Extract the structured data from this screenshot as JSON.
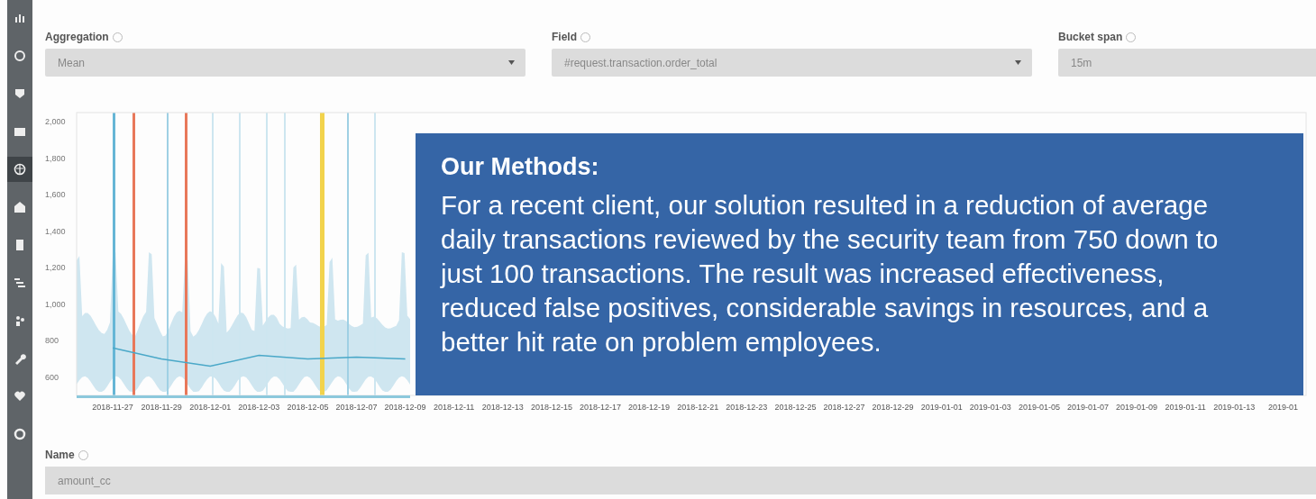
{
  "sidebar": {
    "items": [
      {
        "selected": false
      },
      {
        "selected": false
      },
      {
        "selected": false
      },
      {
        "selected": false
      },
      {
        "selected": true
      },
      {
        "selected": false
      },
      {
        "selected": false
      },
      {
        "selected": false
      },
      {
        "selected": false
      },
      {
        "selected": false
      },
      {
        "selected": false
      },
      {
        "selected": false
      }
    ]
  },
  "fields": [
    {
      "label": "Aggregation",
      "value": "Mean",
      "kind": "select"
    },
    {
      "label": "Field",
      "value": "#request.transaction.order_total",
      "kind": "select"
    },
    {
      "label": "Bucket span",
      "value": "15m",
      "kind": "text"
    }
  ],
  "chart": {
    "chart_data": {
      "type": "line",
      "categories": [
        "2018-11-27",
        "2018-11-29",
        "2018-12-01",
        "2018-12-03",
        "2018-12-05",
        "2018-12-07",
        "2018-12-09",
        "2018-12-11",
        "2018-12-13",
        "2018-12-15",
        "2018-12-17",
        "2018-12-19",
        "2018-12-21",
        "2018-12-23",
        "2018-12-25",
        "2018-12-27",
        "2018-12-29",
        "2019-01-01",
        "2019-01-03",
        "2019-01-05",
        "2019-01-07",
        "2019-01-09",
        "2019-01-11",
        "2019-01-13",
        "2019-01"
      ],
      "ylim": [
        500,
        2050
      ],
      "yticks": [
        {
          "value": 2000,
          "label": "2,000"
        },
        {
          "value": 1800,
          "label": "1,800"
        },
        {
          "value": 1600,
          "label": "1,600"
        },
        {
          "value": 1400,
          "label": "1,400"
        },
        {
          "value": 1200,
          "label": "1,200"
        },
        {
          "value": 1000,
          "label": "1,000"
        },
        {
          "value": 800,
          "label": "800"
        },
        {
          "value": 600,
          "label": "600"
        }
      ],
      "series": [
        {
          "color": "#4aa8c8",
          "values": [
            760,
            700,
            660,
            720,
            700,
            710,
            700,
            null,
            null,
            null,
            null,
            null,
            null,
            null,
            null,
            null,
            null,
            null,
            null,
            null,
            null,
            null,
            null,
            null,
            null
          ]
        }
      ]
    }
  },
  "name_field": {
    "label": "Name",
    "value": "amount_cc"
  },
  "overlay": {
    "title": "Our Methods:",
    "body": "For a recent client, our solution resulted in a reduction of average daily transactions reviewed by the security team from 750 down to just 100 transactions. The result was increased effectiveness, reduced false positives, considerable savings in resources, and a better hit rate on problem employees."
  }
}
